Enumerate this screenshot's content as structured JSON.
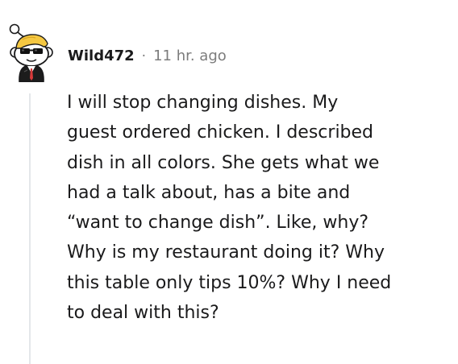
{
  "comment": {
    "username": "Wild472",
    "separator": "·",
    "timestamp": "11 hr. ago",
    "body": "I will stop changing dishes. My\nguest ordered chicken. I described\ndish in all colors. She gets what we\nhad a talk about, has a bite and\n“want to change dish”. Like, why?\nWhy is my restaurant doing it? Why\nthis table only tips 10%? Why I need\nto deal with this?"
  },
  "avatar": {
    "icon": "snoo-avatar-sunglasses-icon",
    "hair_color": "#f5c842",
    "suit_color": "#1c1c1c",
    "tie_color": "#d93a3a"
  },
  "colors": {
    "text": "#1a1a1b",
    "meta": "#7c7c7c",
    "thread_line": "#e4e7ea"
  }
}
